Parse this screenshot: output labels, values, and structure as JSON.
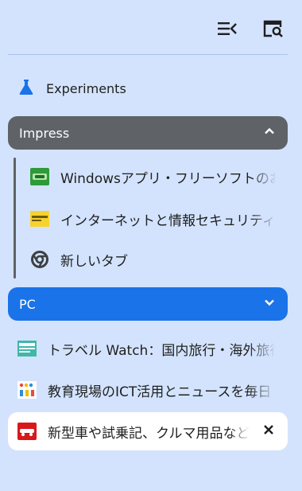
{
  "toolbar": {
    "tab_list_icon": "tab-list-icon",
    "tab_search_icon": "tab-search-icon"
  },
  "experiments": {
    "label": "Experiments",
    "icon": "flask-icon"
  },
  "groups": [
    {
      "name": "Impress",
      "color": "#5f6368",
      "expanded": true,
      "chevron": "chevron-up-icon",
      "tabs": [
        {
          "title": "Windowsアプリ・フリーソフトのおすすめ",
          "favicon": "windows-forest-favicon"
        },
        {
          "title": "インターネットと情報セキュリティの最新",
          "favicon": "internet-watch-favicon"
        },
        {
          "title": "新しいタブ",
          "favicon": "chrome-icon"
        }
      ]
    },
    {
      "name": "PC",
      "color": "#1a73e8",
      "expanded": false,
      "chevron": "chevron-down-icon"
    }
  ],
  "ungrouped_tabs": [
    {
      "title": "トラベル Watch：国内旅行・海外旅行",
      "favicon": "travel-watch-favicon"
    },
    {
      "title": "教育現場のICT活用とニュースを毎日",
      "favicon": "kodomo-ict-favicon"
    },
    {
      "title": "新型車や試乗記、クルマ用品など",
      "favicon": "car-watch-favicon",
      "active": true
    }
  ],
  "colors": {
    "background": "#d3e3fd",
    "active_tab": "#ffffff",
    "accent_blue": "#1a73e8",
    "group_gray": "#5f6368"
  }
}
